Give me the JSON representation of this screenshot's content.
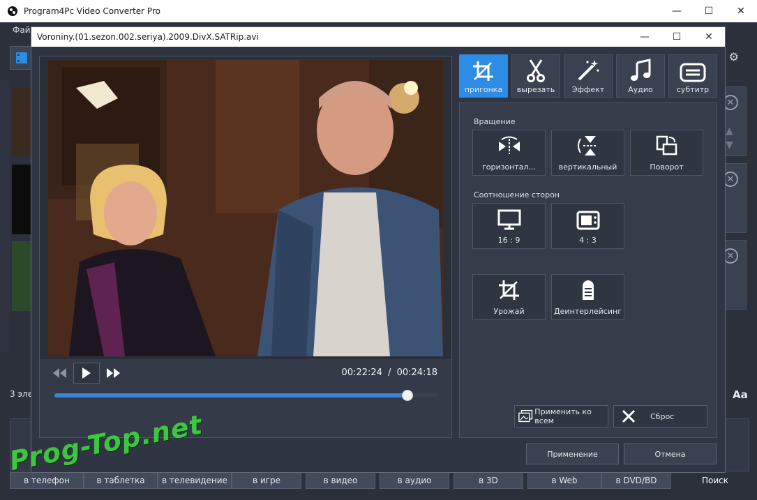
{
  "app": {
    "title": "Program4Pc Video Converter Pro",
    "menu_first": "Файл",
    "items_count": "3 эле",
    "aa_label": "Aa"
  },
  "dialog": {
    "title": "Voroniny.(01.sezon.002.seriya).2009.DivX.SATRip.avi"
  },
  "player": {
    "current_time": "00:22:24",
    "separator": "/",
    "total_time": "00:24:18",
    "progress_fraction": 0.922
  },
  "tabs": [
    {
      "label": "пригонка",
      "icon": "crop-icon",
      "active": true
    },
    {
      "label": "вырезать",
      "icon": "scissors-icon",
      "active": false
    },
    {
      "label": "Эффект",
      "icon": "magic-wand-icon",
      "active": false
    },
    {
      "label": "Аудио",
      "icon": "music-note-icon",
      "active": false
    },
    {
      "label": "субтитр",
      "icon": "subtitle-icon",
      "active": false
    }
  ],
  "rotation": {
    "heading": "Вращение",
    "buttons": [
      {
        "label": "горизонтал...",
        "icon": "flip-horizontal-icon"
      },
      {
        "label": "вертикальный",
        "icon": "flip-vertical-icon"
      },
      {
        "label": "Поворот",
        "icon": "rotate-icon"
      }
    ]
  },
  "aspect": {
    "heading": "Соотношение сторон",
    "buttons": [
      {
        "label": "16 : 9",
        "icon": "monitor-icon"
      },
      {
        "label": "4 : 3",
        "icon": "tv-icon"
      }
    ]
  },
  "extra": {
    "buttons": [
      {
        "label": "Урожай",
        "icon": "crop-icon"
      },
      {
        "label": "Деинтерлейсинг",
        "icon": "deinterlace-icon"
      }
    ]
  },
  "actions": {
    "apply_all": "Применить ко всем",
    "reset": "Сброс",
    "apply": "Применение",
    "cancel": "Отмена"
  },
  "destinations": [
    "в телефон",
    "в таблетка",
    "в телевидение",
    "в игре",
    "в видео",
    "в аудио",
    "в 3D",
    "в Web",
    "в DVD/BD"
  ],
  "search_label": "Поиск",
  "watermark": "Prog-Top.net",
  "colors": {
    "accent": "#2c8ce6",
    "progress": "#3d86d6"
  }
}
